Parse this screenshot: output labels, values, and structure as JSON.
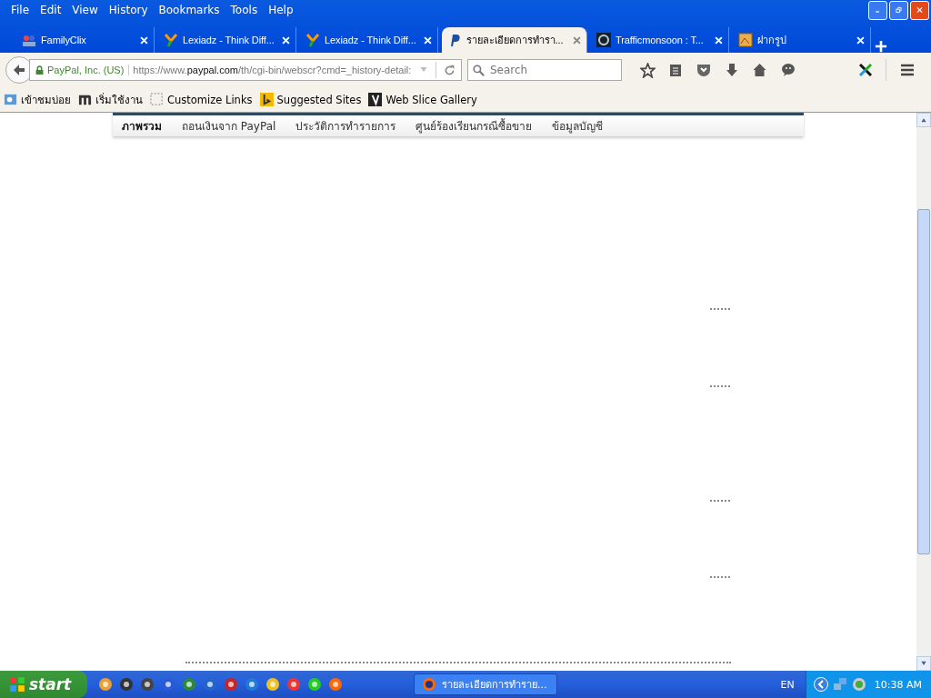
{
  "menu": [
    "File",
    "Edit",
    "View",
    "History",
    "Bookmarks",
    "Tools",
    "Help"
  ],
  "tabs": [
    {
      "title": "FamilyClix",
      "selected": false
    },
    {
      "title": "Lexiadz - Think Diff...",
      "selected": false
    },
    {
      "title": "Lexiadz - Think Diff...",
      "selected": false
    },
    {
      "title": "รายละเอียดการทำรา...",
      "selected": true
    },
    {
      "title": "Trafficmonsoon : T...",
      "selected": false
    },
    {
      "title": "ฝากรูป",
      "selected": false
    }
  ],
  "navbar": {
    "identity": "PayPal, Inc. (US)",
    "url": "https://www.**paypal.com**/th/cgi-bin/webscr?cmd=_history-detail:",
    "search": {
      "placeholder": "Search"
    }
  },
  "bookmarks": [
    "เข้าชมบ่อย",
    "เริ่มใช้งาน",
    "Customize Links",
    "Suggested Sites",
    "Web Slice Gallery"
  ],
  "page_nav": [
    {
      "label": "ภาพรวม",
      "selected": true
    },
    {
      "label": "ถอนเงินจาก PayPal",
      "selected": false
    },
    {
      "label": "ประวัติการทำรายการ",
      "selected": false
    },
    {
      "label": "ศูนย์ร้องเรียนกรณีซื้อขาย",
      "selected": false
    },
    {
      "label": "ข้อมูลบัญชี",
      "selected": false
    }
  ],
  "taskbar": {
    "start": "start",
    "window": "รายละเอียดการทำราย...",
    "language": "EN",
    "clock": "10:38 AM"
  }
}
